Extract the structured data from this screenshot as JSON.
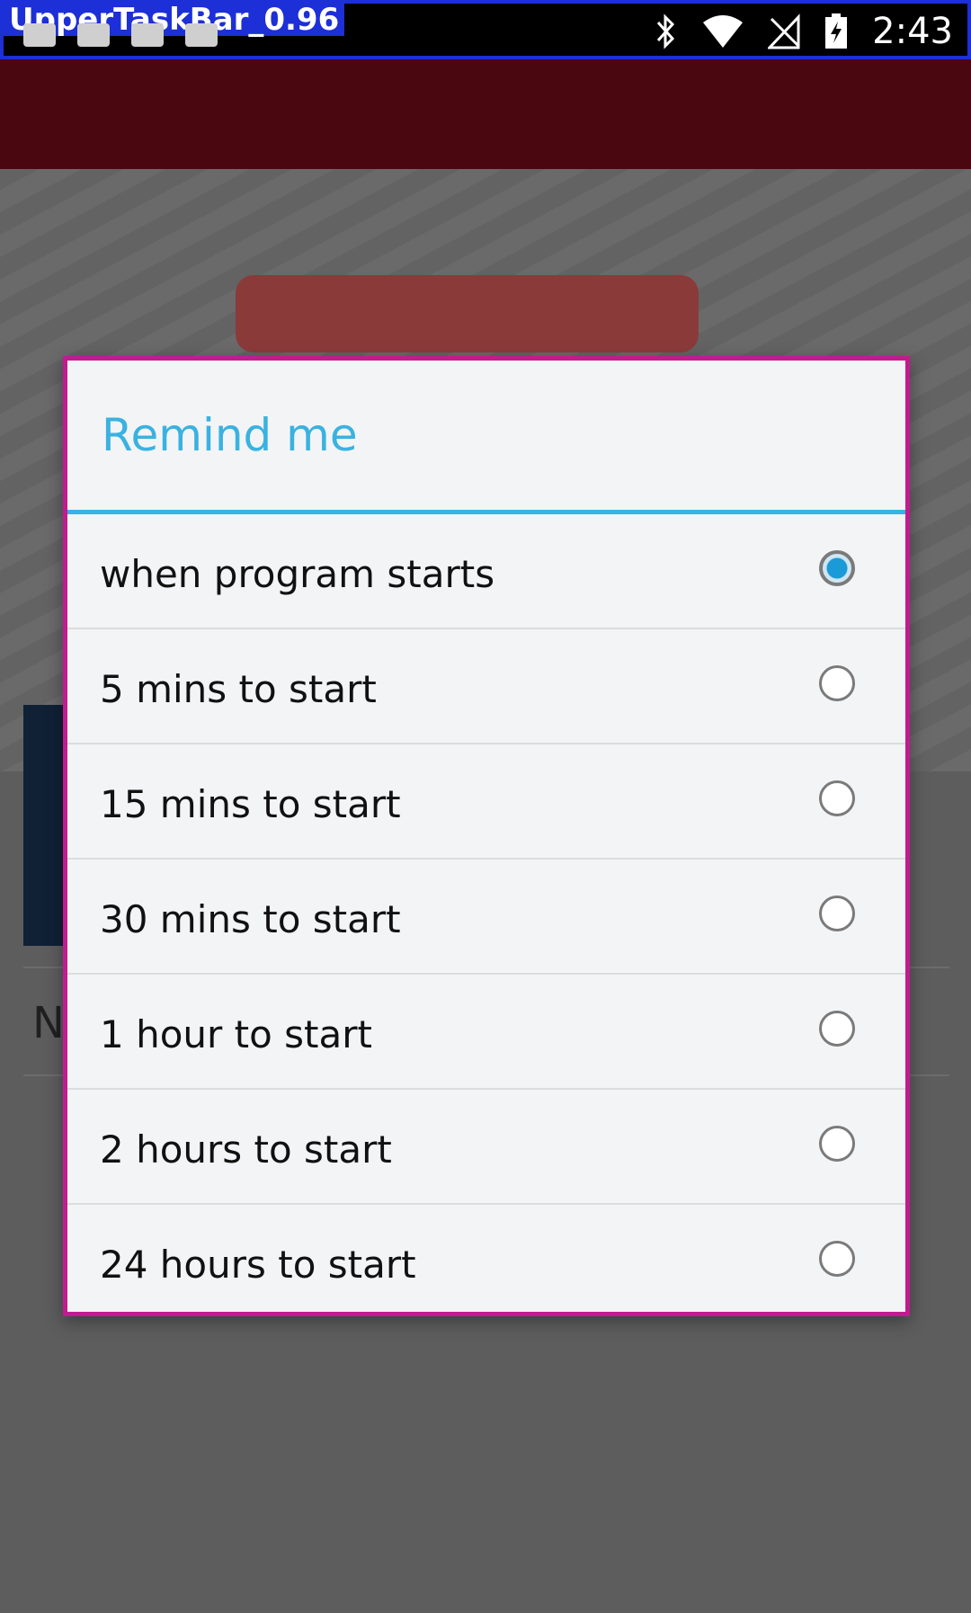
{
  "status_bar": {
    "tag_label": "UpperTaskBar_0.96",
    "time": "2:43",
    "icons": [
      "bluetooth-icon",
      "wifi-icon",
      "no-signal-icon",
      "battery-charging-icon"
    ]
  },
  "dialog": {
    "title": "Remind me",
    "options": [
      {
        "label": "when program starts",
        "checked": true
      },
      {
        "label": "5 mins to start",
        "checked": false
      },
      {
        "label": "15 mins to start",
        "checked": false
      },
      {
        "label": "30 mins to start",
        "checked": false
      },
      {
        "label": "1 hour to start",
        "checked": false
      },
      {
        "label": "2 hours to start",
        "checked": false
      },
      {
        "label": "24 hours to start",
        "checked": false
      }
    ]
  },
  "background": {
    "partial_letter": "N"
  },
  "colors": {
    "accent": "#33b5e5",
    "title": "#3ab2e0",
    "radio_checked": "#1a9ad6",
    "header": "#4b0710"
  }
}
